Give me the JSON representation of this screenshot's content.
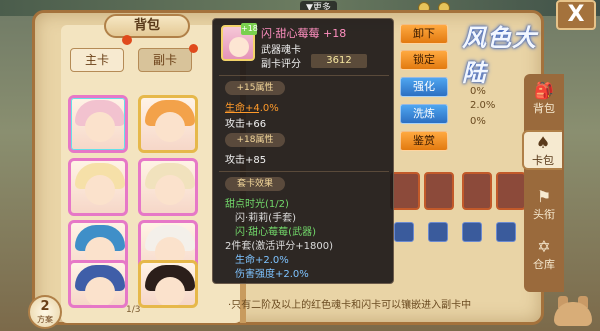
{
  "top": {
    "menu_label": "▼更多"
  },
  "inventory": {
    "title": "背包",
    "tabs": [
      {
        "label": "主卡"
      },
      {
        "label": "副卡"
      }
    ],
    "page_indicator": "1/3",
    "scheme": {
      "number": "2",
      "label": "方案"
    },
    "footnote": "·只有二阶及以上的红色魂卡和闪卡可以镶嵌进入副卡中"
  },
  "cards": [
    {
      "hair": "#f2c2cf",
      "frame": "pink",
      "selected": true
    },
    {
      "hair": "#f3a24a",
      "frame": "gold"
    },
    {
      "hair": "#f6e0a8",
      "frame": "pink"
    },
    {
      "hair": "#f1e2bd",
      "frame": "pink"
    },
    {
      "hair": "#3f8fc8",
      "frame": "pink"
    },
    {
      "hair": "#f4f0ea",
      "frame": "pink"
    },
    {
      "hair": "#3f5ea8",
      "frame": "pink"
    },
    {
      "hair": "#2b1e1a",
      "frame": "gold"
    }
  ],
  "popup": {
    "plus_badge": "+18",
    "name": "闪·甜心莓莓 +18",
    "type": "武器魂卡",
    "score_label": "副卡评分",
    "score": "3612",
    "sec1_header": "+15属性",
    "sec1_line1": "生命+4.0%",
    "sec1_line2": "攻击+66",
    "sec2_header": "+18属性",
    "sec2_line1": "攻击+85",
    "sec3_header": "套卡效果",
    "set_name": "甜点时光(1/2)",
    "set_item1": "闪·莉莉(手套)",
    "set_item2": "闪·甜心莓莓(武器)",
    "set_bonus": "2件套(激活评分+1800)",
    "bonus1": "生命+2.0%",
    "bonus2": "伤害强度+2.0%"
  },
  "actions": [
    {
      "label": "卸下",
      "style": "orange"
    },
    {
      "label": "锁定",
      "style": "orange"
    },
    {
      "label": "强化",
      "style": "blue"
    },
    {
      "label": "洗炼",
      "style": "blue"
    },
    {
      "label": "鉴赏",
      "style": "orange"
    }
  ],
  "logo": {
    "text": "风色大陆"
  },
  "right_stats": {
    "pct1": "0%",
    "pct2": "2.0%",
    "pct3": "0%"
  },
  "side_nav": [
    {
      "label": "背包",
      "icon": "🎒"
    },
    {
      "label": "卡包",
      "icon": "♠"
    },
    {
      "label": "头衔",
      "icon": "⚑"
    },
    {
      "label": "仓库",
      "icon": "✡"
    }
  ],
  "close_label": "X"
}
